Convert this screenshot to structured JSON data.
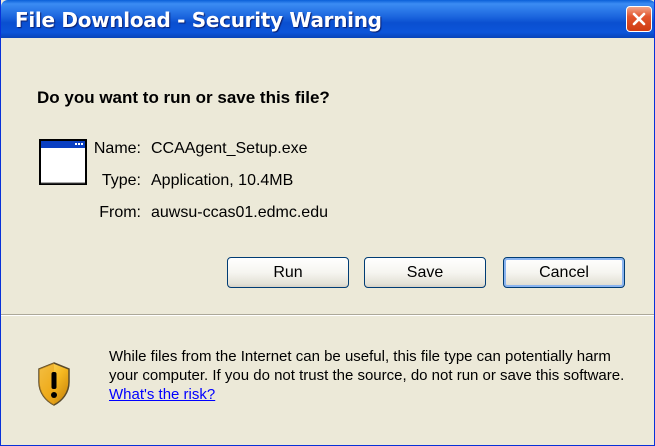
{
  "window": {
    "title": "File Download - Security Warning"
  },
  "icons": {
    "close": "close-icon",
    "app": "application-window-icon",
    "warning": "security-shield-warning-icon"
  },
  "question": "Do you want to run or save this file?",
  "file": {
    "name_label": "Name:",
    "name_value": "CCAAgent_Setup.exe",
    "type_label": "Type:",
    "type_value": "Application, 10.4MB",
    "from_label": "From:",
    "from_value": "auwsu-ccas01.edmc.edu"
  },
  "buttons": {
    "run": "Run",
    "save": "Save",
    "cancel": "Cancel"
  },
  "warning": {
    "text": "While files from the Internet can be useful, this file type can potentially harm your computer. If you do not trust the source, do not run or save this software. ",
    "link": "What's the risk?"
  },
  "colors": {
    "titlebar": "#0a4fd0",
    "dialog_bg": "#ece9d8",
    "close_button": "#e2552e",
    "link": "#0000ff"
  }
}
